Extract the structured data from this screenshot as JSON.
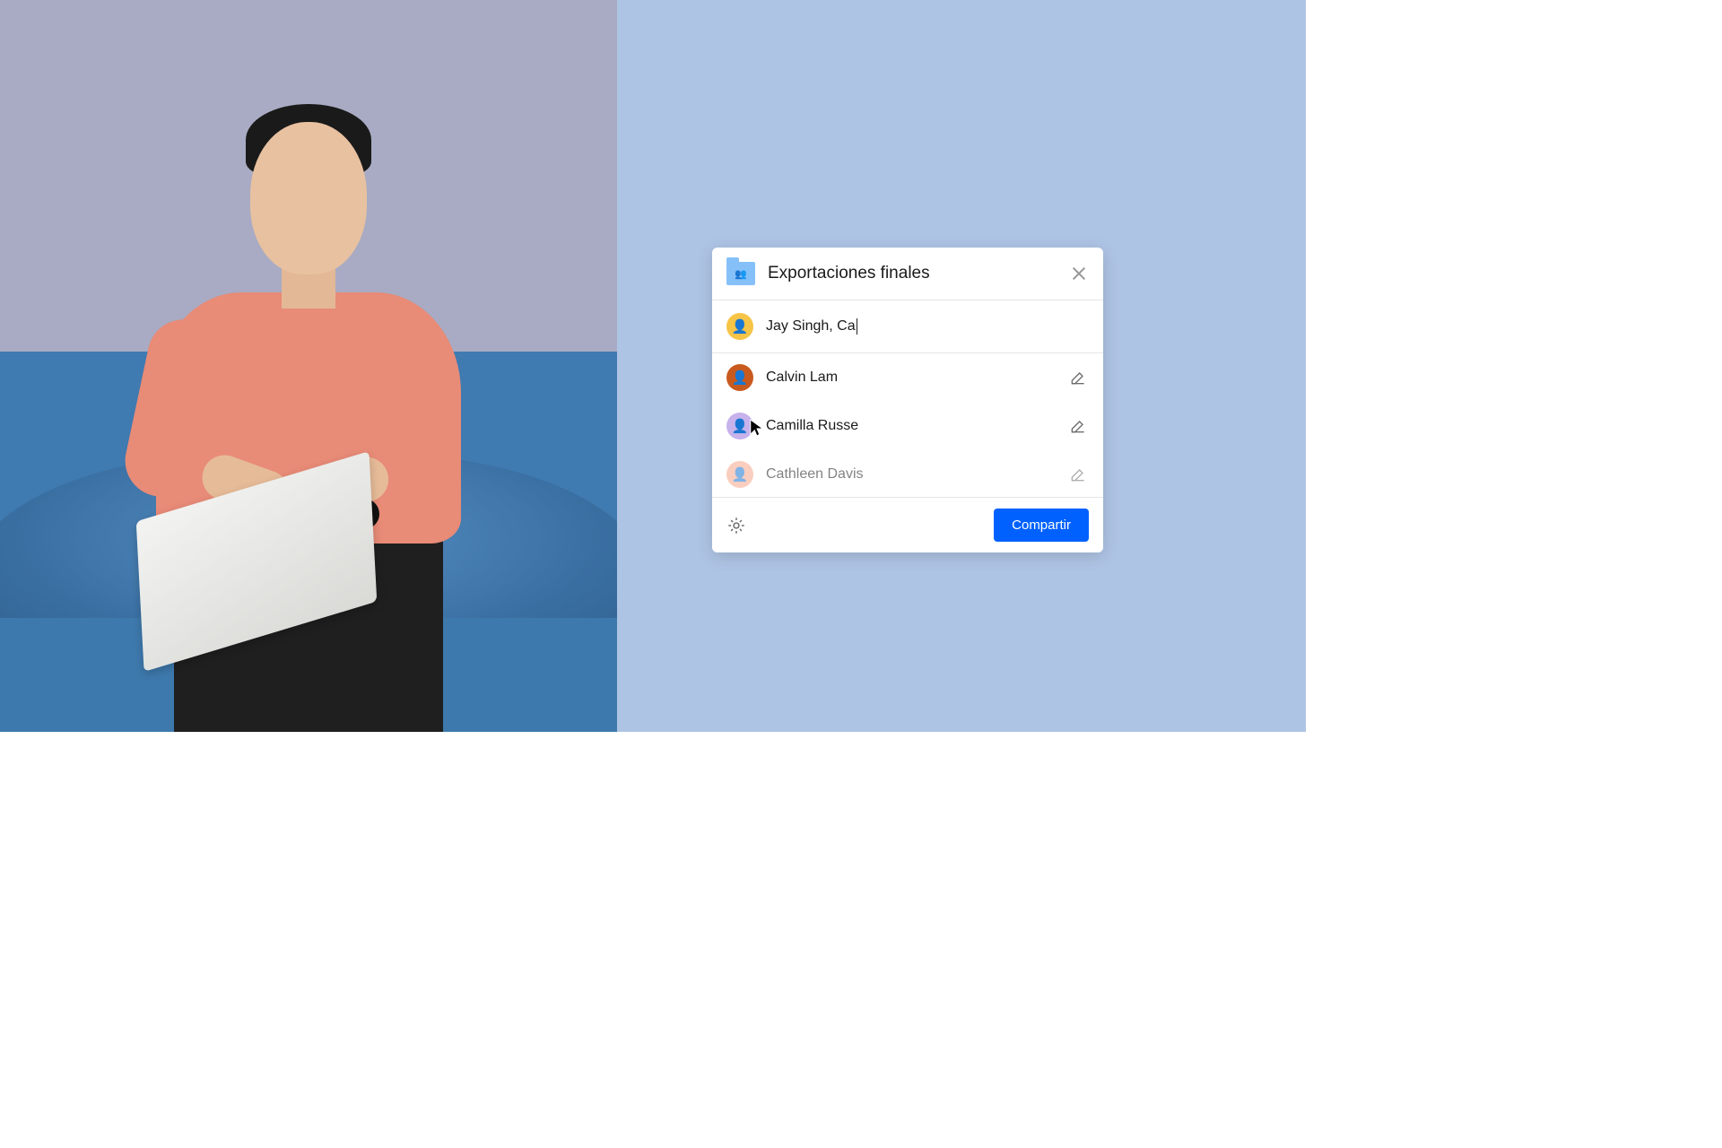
{
  "colors": {
    "accent": "#0061fe",
    "panel_bg": "#aec4e4",
    "folder": "#86c0f9"
  },
  "dialog": {
    "title": "Exportaciones finales",
    "input_value": "Jay Singh, Ca",
    "suggestions": [
      {
        "name": "Calvin Lam",
        "avatar_bg": "#c95a1e"
      },
      {
        "name": "Camilla Russe",
        "avatar_bg": "#c7b2ec"
      },
      {
        "name": "Cathleen Davis",
        "avatar_bg": "#f5a78b"
      }
    ],
    "input_avatar_bg": "#f6c446",
    "share_button": "Compartir"
  }
}
